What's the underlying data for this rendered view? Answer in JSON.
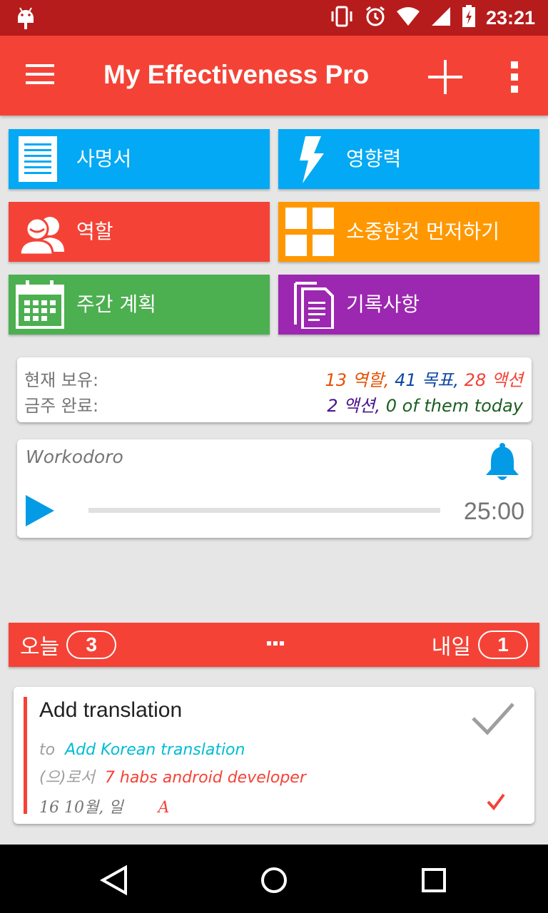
{
  "status": {
    "time": "23:21"
  },
  "appbar": {
    "title": "My Effectiveness Pro"
  },
  "tiles": [
    {
      "label": "사명서",
      "icon": "document-lines-icon",
      "color": "#03a9f4"
    },
    {
      "label": "영향력",
      "icon": "lightning-icon",
      "color": "#03a9f4"
    },
    {
      "label": "역할",
      "icon": "people-icon",
      "color": "#f44336"
    },
    {
      "label": "소중한것 먼저하기",
      "icon": "quadrants-icon",
      "color": "#ff9800"
    },
    {
      "label": "주간 계획",
      "icon": "calendar-icon",
      "color": "#4caf50"
    },
    {
      "label": "기록사항",
      "icon": "notes-icon",
      "color": "#9c27b0"
    }
  ],
  "stats": {
    "current_label": "현재 보유:",
    "roles": "13 역할",
    "goals": "41 목표",
    "actions": "28 액션",
    "week_label": "금주 완료:",
    "done_actions": "2 액션",
    "done_today": "0 of them today",
    "colors": {
      "roles": "#e65100",
      "goals": "#0d47a1",
      "actions": "#f44336",
      "done_actions": "#4a148c",
      "done_today": "#1b5e20"
    }
  },
  "workodoro": {
    "title": "Workodoro",
    "timer": "25:00",
    "progress": 0,
    "accent": "#039be5"
  },
  "daybar": {
    "today_label": "오늘",
    "today_count": "3",
    "tomorrow_label": "내일",
    "tomorrow_count": "1"
  },
  "task": {
    "title": "Add translation",
    "to_label": "to",
    "to_value": "Add Korean translation",
    "role_label": "(으)로서",
    "role_value": "7 habs android developer",
    "date": "16 10월, 일",
    "priority": "A"
  },
  "separators": {
    "comma": ","
  }
}
